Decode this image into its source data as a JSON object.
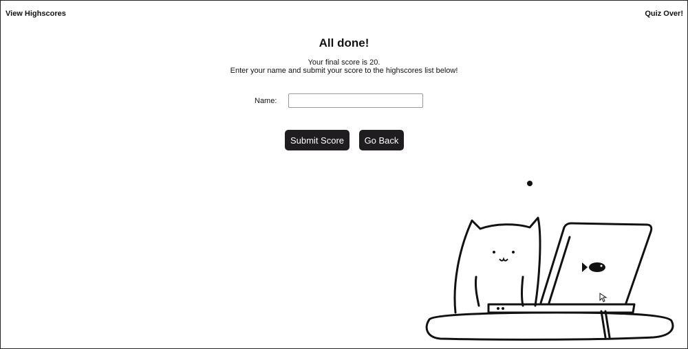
{
  "header": {
    "highscores_link": "View Highscores",
    "status": "Quiz Over!"
  },
  "main": {
    "title": "All done!",
    "score_line": "Your final score is 20.",
    "instruction_line": "Enter your name and submit your score to the highscores list below!",
    "name_label": "Name:",
    "name_value": "",
    "submit_label": "Submit Score",
    "back_label": "Go Back"
  },
  "illustration": {
    "subject": "cat-using-laptop",
    "screen_icon": "fish-icon"
  },
  "colors": {
    "button_bg": "#1f1d20",
    "button_text": "#ffffff",
    "text": "#111111",
    "background": "#ffffff"
  }
}
